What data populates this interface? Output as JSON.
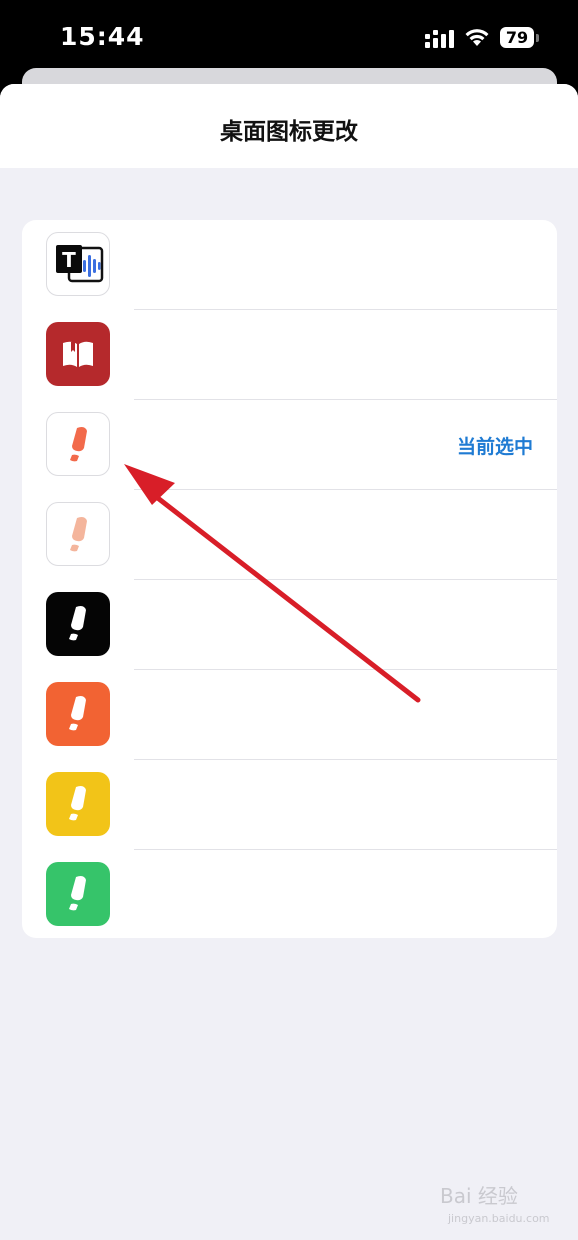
{
  "status": {
    "time": "15:44",
    "battery": "79",
    "icons": [
      "signal-icon",
      "wifi-icon",
      "battery-icon"
    ]
  },
  "nav": {
    "title": "桌面图标更改"
  },
  "icons": [
    {
      "name": "t-voice-icon",
      "bg": "#ffffff",
      "border": true,
      "selected_label": ""
    },
    {
      "name": "red-book-icon",
      "bg": "#b5292c",
      "border": false,
      "selected_label": ""
    },
    {
      "name": "orange-eraser-icon-white",
      "bg": "#ffffff",
      "border": true,
      "selected_label": "当前选中"
    },
    {
      "name": "pink-eraser-icon-white",
      "bg": "#ffffff",
      "border": true,
      "selected_label": ""
    },
    {
      "name": "black-eraser-icon",
      "bg": "#050505",
      "border": false,
      "selected_label": ""
    },
    {
      "name": "orange-eraser-icon",
      "bg": "#f26333",
      "border": false,
      "selected_label": ""
    },
    {
      "name": "yellow-eraser-icon",
      "bg": "#f2c418",
      "border": false,
      "selected_label": ""
    },
    {
      "name": "green-eraser-icon",
      "bg": "#36c46a",
      "border": false,
      "selected_label": ""
    }
  ],
  "selected_label": "当前选中",
  "watermark": {
    "main": "Bai 经验",
    "sub": "jingyan.baidu.com"
  },
  "colors": {
    "accent": "#1f7bd3",
    "arrow": "#d81e28",
    "background": "#f0f0f6"
  }
}
